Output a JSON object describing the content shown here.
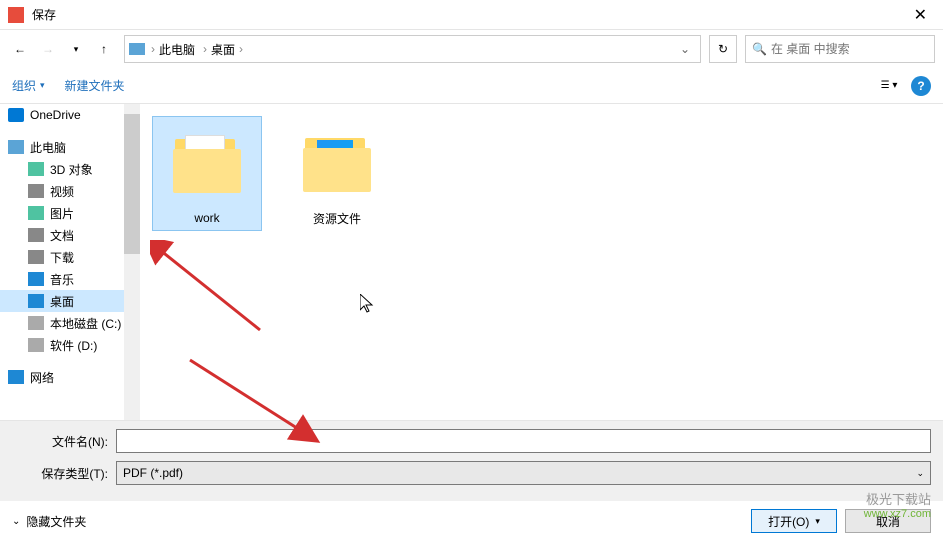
{
  "titlebar": {
    "title": "保存"
  },
  "nav": {
    "breadcrumb": {
      "root": "此电脑",
      "current": "桌面"
    },
    "search": {
      "placeholder": "在 桌面 中搜索"
    }
  },
  "toolbar": {
    "organize": "组织",
    "new_folder": "新建文件夹"
  },
  "sidebar": {
    "items": [
      {
        "label": "OneDrive",
        "icon": "onedrive",
        "level": 0
      },
      {
        "label": "此电脑",
        "icon": "pc",
        "level": 0
      },
      {
        "label": "3D 对象",
        "icon": "3d",
        "level": 1
      },
      {
        "label": "视频",
        "icon": "video",
        "level": 1
      },
      {
        "label": "图片",
        "icon": "pictures",
        "level": 1
      },
      {
        "label": "文档",
        "icon": "documents",
        "level": 1
      },
      {
        "label": "下载",
        "icon": "downloads",
        "level": 1
      },
      {
        "label": "音乐",
        "icon": "music",
        "level": 1
      },
      {
        "label": "桌面",
        "icon": "desktop",
        "level": 1,
        "selected": true
      },
      {
        "label": "本地磁盘 (C:)",
        "icon": "disk",
        "level": 1
      },
      {
        "label": "软件 (D:)",
        "icon": "disk",
        "level": 1
      },
      {
        "label": "网络",
        "icon": "network",
        "level": 0
      }
    ]
  },
  "content": {
    "folders": [
      {
        "name": "work",
        "selected": true,
        "overlay": "papers"
      },
      {
        "name": "资源文件",
        "selected": false,
        "overlay": "blue"
      }
    ]
  },
  "fields": {
    "filename_label": "文件名(N):",
    "filename_value": "",
    "filetype_label": "保存类型(T):",
    "filetype_value": "PDF (*.pdf)"
  },
  "footer": {
    "hide_folders": "隐藏文件夹",
    "open": "打开(O)",
    "cancel": "取消"
  },
  "watermark": {
    "line1": "极光下载站",
    "line2": "www.xz7.com"
  }
}
